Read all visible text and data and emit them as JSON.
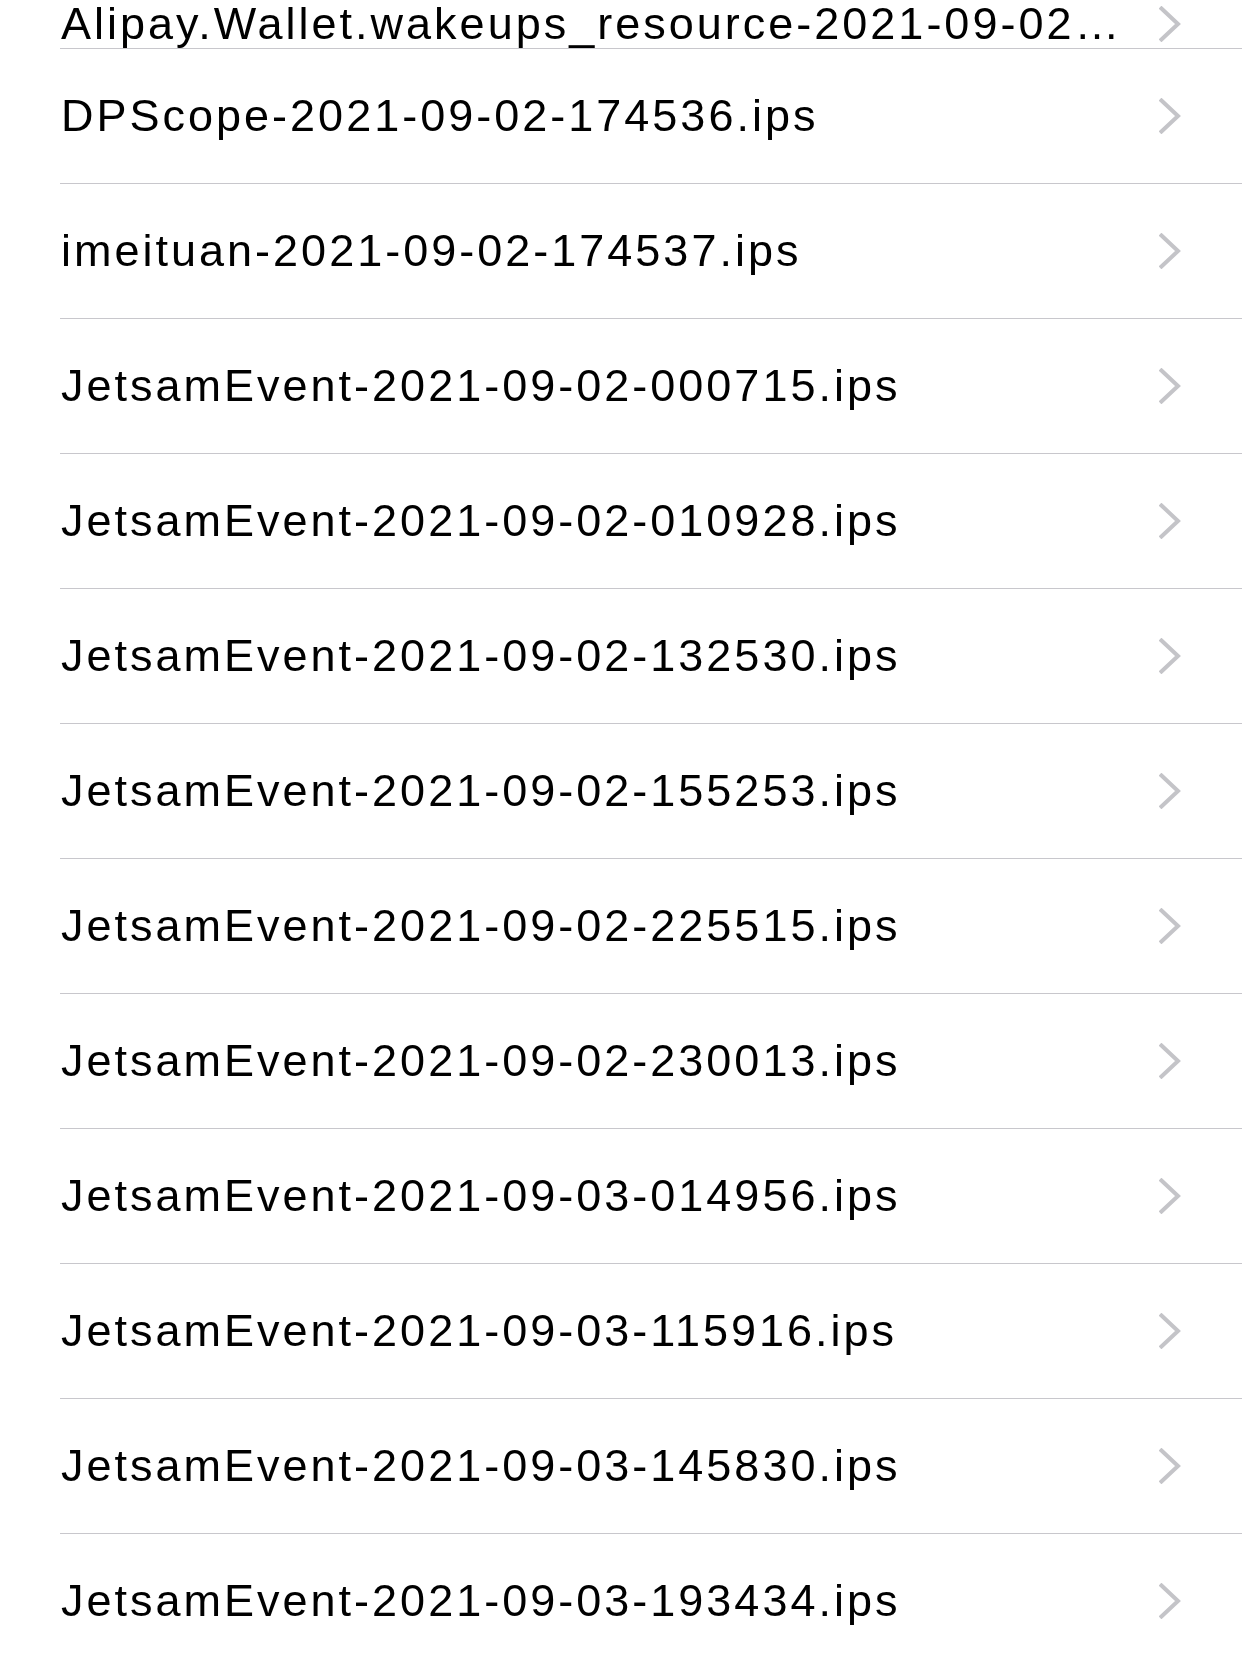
{
  "rows": [
    {
      "name": "Alipay.Wallet.wakeups_resource-2021-09-02…"
    },
    {
      "name": "DPScope-2021-09-02-174536.ips"
    },
    {
      "name": "imeituan-2021-09-02-174537.ips"
    },
    {
      "name": "JetsamEvent-2021-09-02-000715.ips"
    },
    {
      "name": "JetsamEvent-2021-09-02-010928.ips"
    },
    {
      "name": "JetsamEvent-2021-09-02-132530.ips"
    },
    {
      "name": "JetsamEvent-2021-09-02-155253.ips"
    },
    {
      "name": "JetsamEvent-2021-09-02-225515.ips"
    },
    {
      "name": "JetsamEvent-2021-09-02-230013.ips"
    },
    {
      "name": "JetsamEvent-2021-09-03-014956.ips"
    },
    {
      "name": "JetsamEvent-2021-09-03-115916.ips"
    },
    {
      "name": "JetsamEvent-2021-09-03-145830.ips"
    },
    {
      "name": "JetsamEvent-2021-09-03-193434.ips"
    }
  ]
}
